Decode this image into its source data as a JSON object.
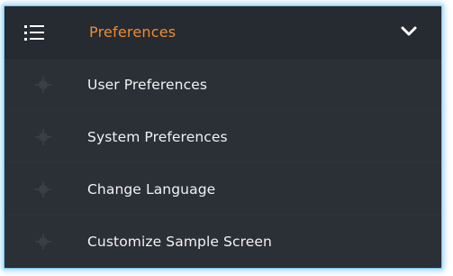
{
  "menu": {
    "header": {
      "title": "Preferences",
      "icon": "list-menu-icon",
      "expand_icon": "chevron-down-icon",
      "expanded": true
    },
    "items": [
      {
        "label": "User Preferences",
        "icon": "crosshair-bullet-icon"
      },
      {
        "label": "System Preferences",
        "icon": "crosshair-bullet-icon"
      },
      {
        "label": "Change Language",
        "icon": "crosshair-bullet-icon"
      },
      {
        "label": "Customize Sample Screen",
        "icon": "crosshair-bullet-icon"
      }
    ]
  },
  "colors": {
    "panel_background": "#2b2f36",
    "header_title": "#ef8c2f",
    "item_text": "#f2f2f2",
    "focus_outline": "#79c3ee"
  }
}
